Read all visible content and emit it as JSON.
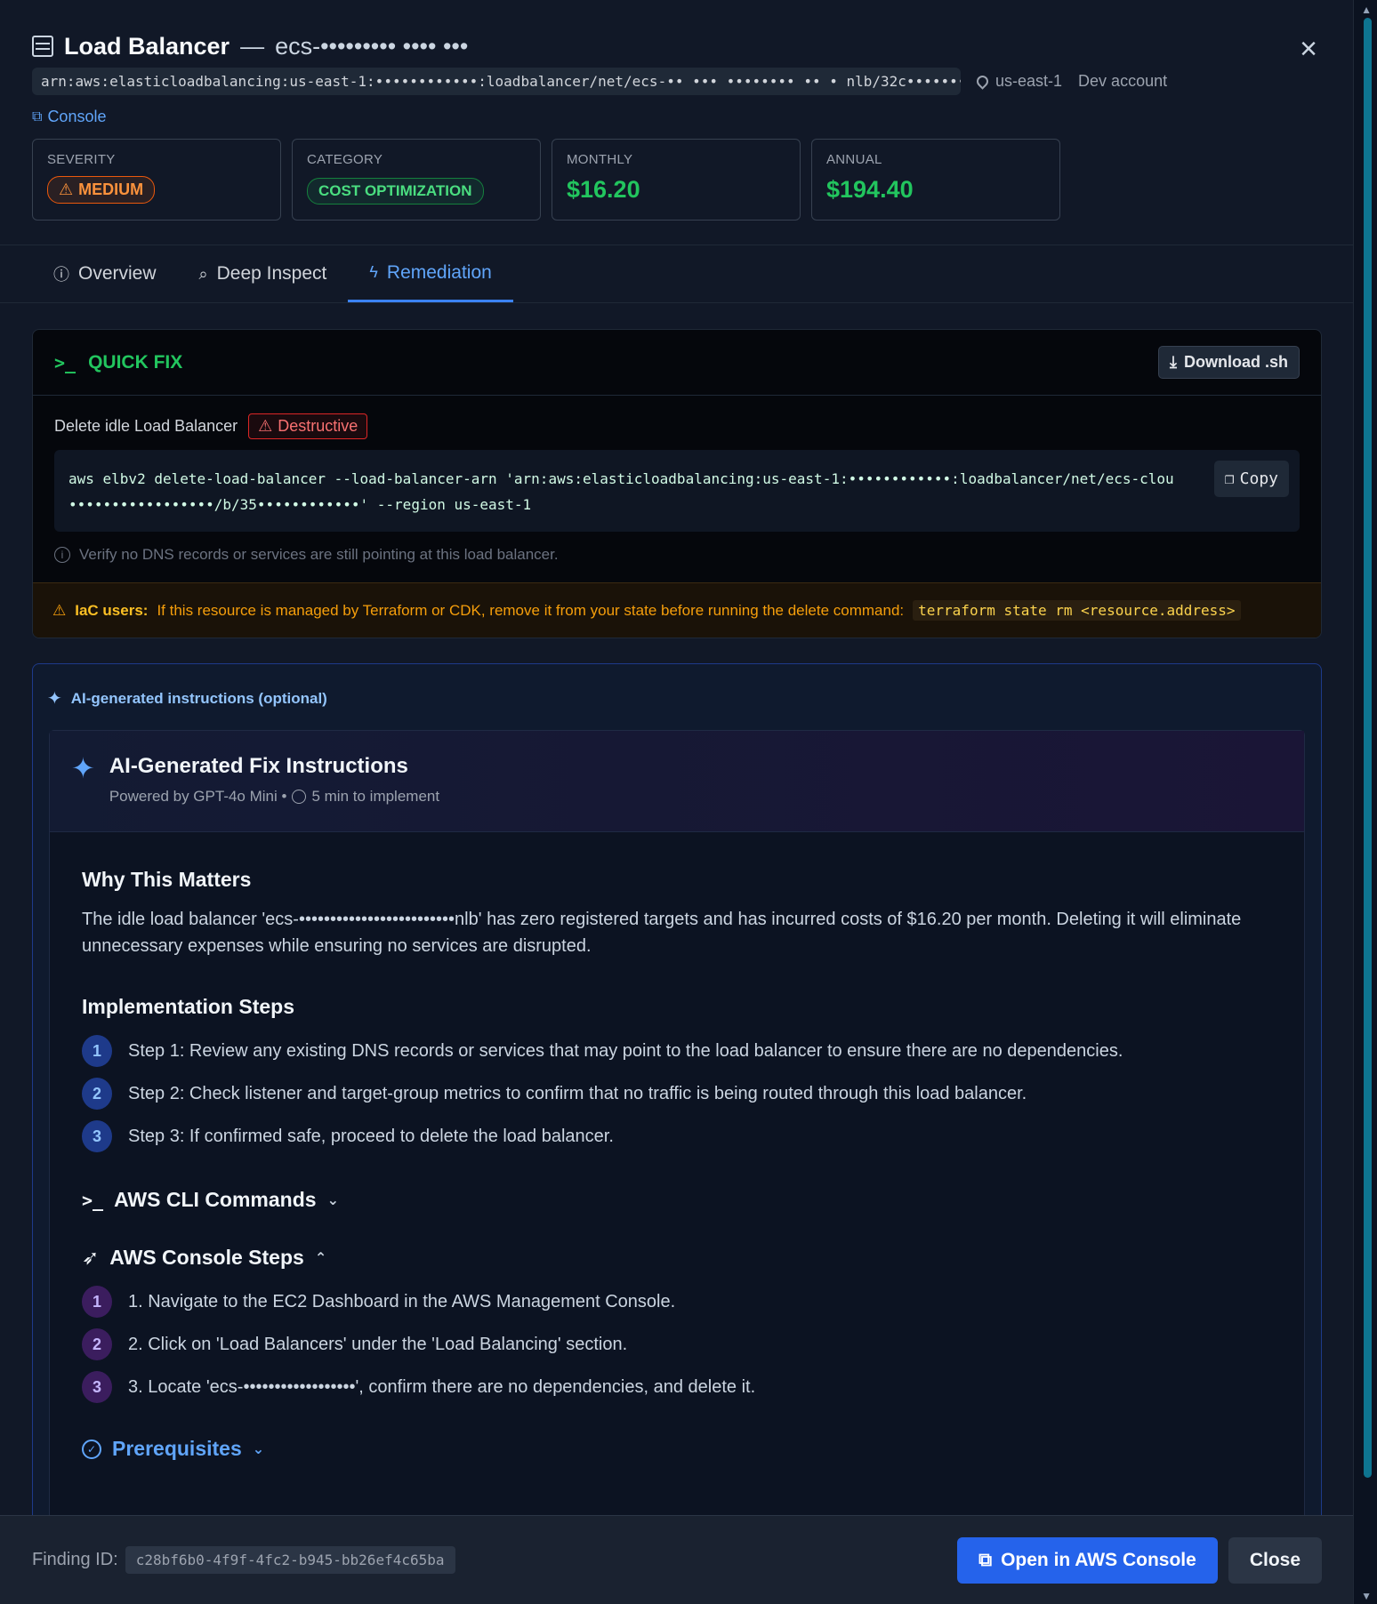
{
  "header": {
    "title": "Load Balancer",
    "separator": "—",
    "resource_name": "ecs-••••••••• •••• •••",
    "arn": "arn:aws:elasticloadbalancing:us-east-1:••••••••••••:loadbalancer/net/ecs-•• ••• •••••••• •• • nlb/32c••••••••••",
    "region": "us-east-1",
    "account": "Dev account",
    "console_link": "Console",
    "close_icon": "close-icon"
  },
  "stats": {
    "severity_label": "SEVERITY",
    "severity_value": "MEDIUM",
    "category_label": "CATEGORY",
    "category_value": "COST OPTIMIZATION",
    "monthly_label": "MONTHLY",
    "monthly_value": "$16.20",
    "annual_label": "ANNUAL",
    "annual_value": "$194.40"
  },
  "tabs": [
    {
      "label": "Overview",
      "icon": "info-icon"
    },
    {
      "label": "Deep Inspect",
      "icon": "search-icon"
    },
    {
      "label": "Remediation",
      "icon": "bolt-icon",
      "active": true
    }
  ],
  "quick_fix": {
    "title": "QUICK FIX",
    "download_label": "Download .sh",
    "description": "Delete idle Load Balancer",
    "destructive_label": "Destructive",
    "command_line1": "aws elbv2 delete-load-balancer --load-balancer-arn 'arn:aws:elasticloadbalancing:us-east-1:••••••••••••:loadbalancer/net/ecs-clou",
    "command_line2": "    •••••••••••••••••/b/35••••••••••••' --region us-east-1",
    "copy_label": "Copy",
    "verify_note": "Verify no DNS records or services are still pointing at this load balancer.",
    "iac_label": "IaC users:",
    "iac_text": "If this resource is managed by Terraform or CDK, remove it from your state before running the delete command:",
    "iac_command": "terraform state rm <resource.address>"
  },
  "ai": {
    "section_label": "AI-generated instructions (optional)",
    "card_title": "AI-Generated Fix Instructions",
    "powered_by": "Powered by GPT-4o Mini •",
    "time_estimate": "5 min to implement",
    "why_title": "Why This Matters",
    "why_text": "The idle load balancer 'ecs-•••••••••••••••••••••••••nlb' has zero registered targets and has incurred costs of $16.20 per month. Deleting it will eliminate unnecessary expenses while ensuring no services are disrupted.",
    "impl_title": "Implementation Steps",
    "impl_steps": [
      {
        "num": "1",
        "text": "Step 1: Review any existing DNS records or services that may point to the load balancer to ensure there are no dependencies."
      },
      {
        "num": "2",
        "text": "Step 2: Check listener and target-group metrics to confirm that no traffic is being routed through this load balancer."
      },
      {
        "num": "3",
        "text": "Step 3: If confirmed safe, proceed to delete the load balancer."
      }
    ],
    "cli_title": "AWS CLI Commands",
    "console_title": "AWS Console Steps",
    "console_steps": [
      {
        "num": "1",
        "text": "1. Navigate to the EC2 Dashboard in the AWS Management Console."
      },
      {
        "num": "2",
        "text": "2. Click on 'Load Balancers' under the 'Load Balancing' section."
      },
      {
        "num": "3",
        "text": "3. Locate 'ecs-••••••••••••••••••', confirm there are no dependencies, and delete it."
      }
    ],
    "prereq_title": "Prerequisites"
  },
  "footer": {
    "finding_label": "Finding ID:",
    "finding_id": "c28bf6b0-4f9f-4fc2-b945-bb26ef4c65ba",
    "open_console_label": "Open in AWS Console",
    "close_label": "Close"
  },
  "colors": {
    "accent": "#3b82f6",
    "success": "#22c55e",
    "warning": "#f59e0b",
    "danger": "#dc2626"
  }
}
